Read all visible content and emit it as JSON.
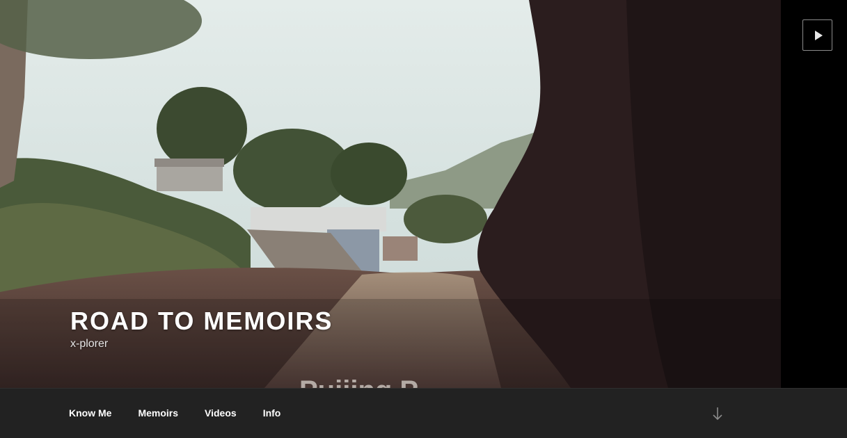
{
  "header": {
    "site_title": "ROAD TO MEMOIRS",
    "site_description": "x-plorer"
  },
  "video": {
    "play_icon": "play-icon",
    "caption_partial": "Pujjing P"
  },
  "navigation": {
    "items": [
      {
        "label": "Know Me"
      },
      {
        "label": "Memoirs"
      },
      {
        "label": "Videos"
      },
      {
        "label": "Info"
      }
    ],
    "scroll_icon": "arrow-down-icon"
  },
  "colors": {
    "nav_background": "#222222",
    "nav_text": "#ffffff",
    "title_text": "#ffffff"
  }
}
